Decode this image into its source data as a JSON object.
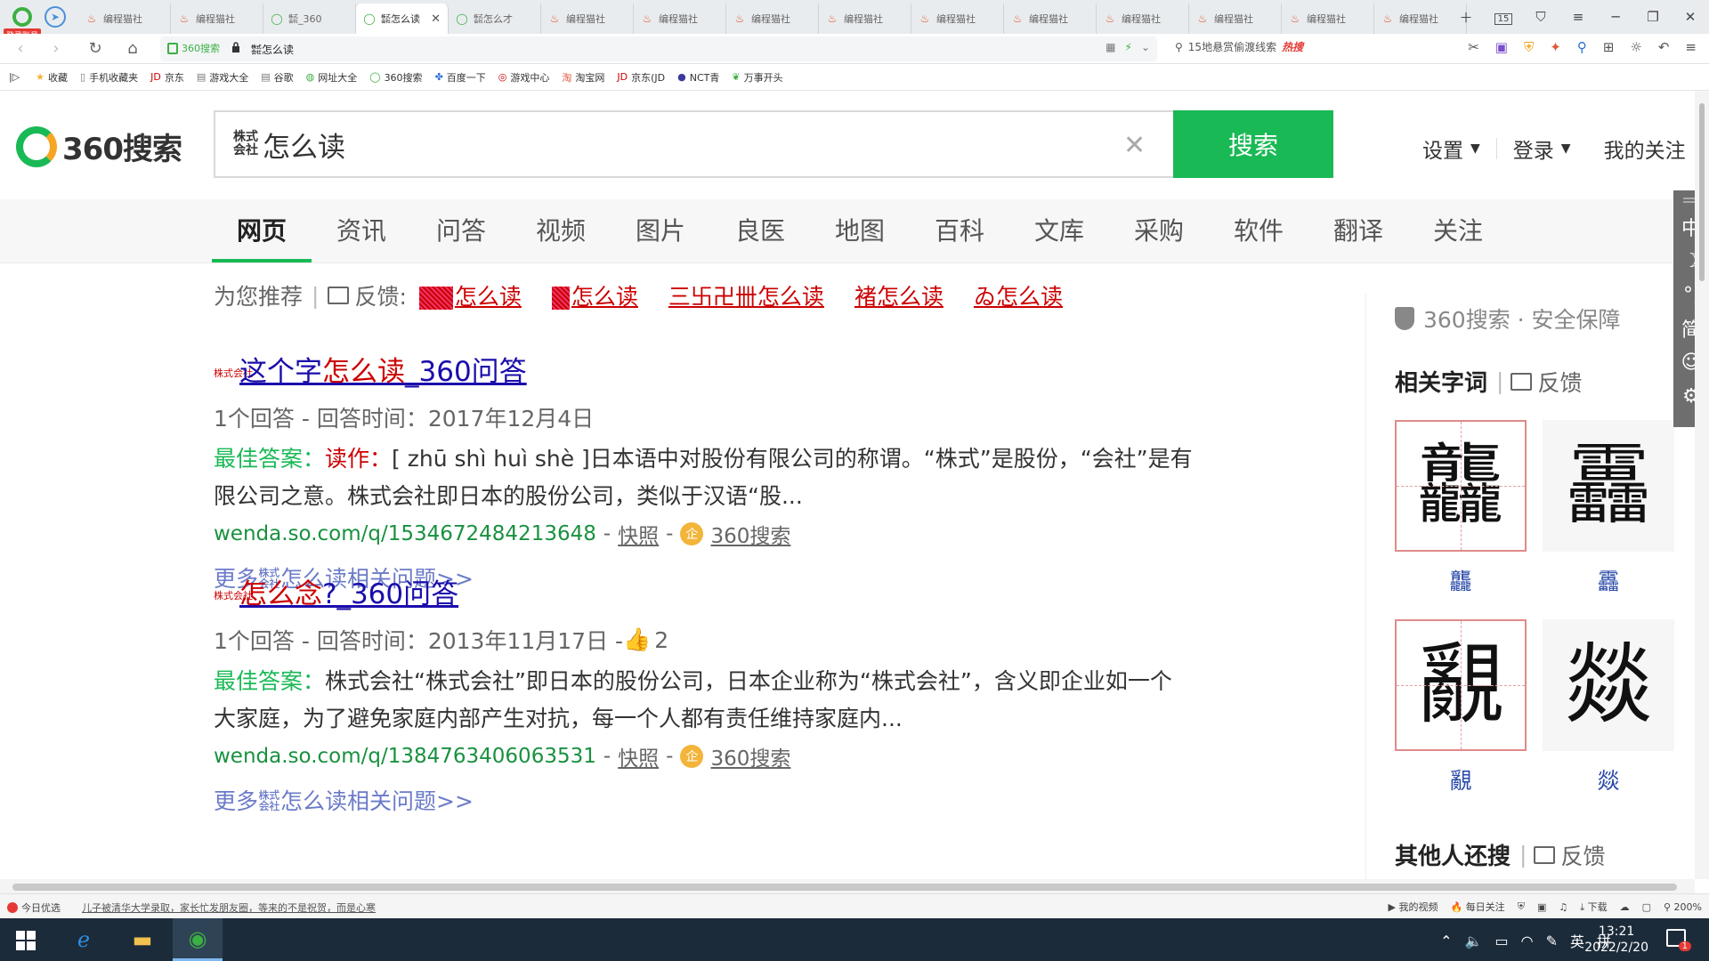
{
  "browser": {
    "account_badge": "登录账号",
    "tabs": [
      {
        "title": "编程猫社",
        "icon": "fire-icon",
        "active": false
      },
      {
        "title": "编程猫社",
        "icon": "fire-icon",
        "active": false
      },
      {
        "title": "㍿_360",
        "icon": "360-search-icon",
        "active": false
      },
      {
        "title": "㍿怎么读",
        "icon": "360-search-icon",
        "active": true
      },
      {
        "title": "㍿怎么才",
        "icon": "360-search-icon",
        "active": false
      },
      {
        "title": "编程猫社",
        "icon": "fire-icon",
        "active": false
      },
      {
        "title": "编程猫社",
        "icon": "fire-icon",
        "active": false
      },
      {
        "title": "编程猫社",
        "icon": "fire-icon",
        "active": false
      },
      {
        "title": "编程猫社",
        "icon": "fire-icon",
        "active": false
      },
      {
        "title": "编程猫社",
        "icon": "fire-icon",
        "active": false
      },
      {
        "title": "编程猫社",
        "icon": "fire-icon",
        "active": false
      },
      {
        "title": "编程猫社",
        "icon": "fire-icon",
        "active": false
      },
      {
        "title": "编程猫社",
        "icon": "fire-icon",
        "active": false
      },
      {
        "title": "编程猫社",
        "icon": "fire-icon",
        "active": false
      },
      {
        "title": "编程猫社",
        "icon": "fire-icon",
        "active": false
      }
    ],
    "tab_count": "15",
    "security_label": "360搜索",
    "url": "㍿怎么读",
    "hot_search_text": "15地悬赏偷渡线索",
    "hot_label": "热搜"
  },
  "bookmarks": [
    "收藏",
    "手机收藏夹",
    "京东",
    "游戏大全",
    "谷歌",
    "网址大全",
    "360搜索",
    "百度一下",
    "游戏中心",
    "淘宝网",
    "京东(JD",
    "NCT青",
    "万事开头"
  ],
  "search": {
    "logo_text": "360搜索",
    "query_glyph": "株式会社",
    "query_text": "怎么读",
    "button_label": "搜索",
    "links": {
      "settings": "设置",
      "login": "登录",
      "follow": "我的关注"
    }
  },
  "vertical_tabs": [
    "网页",
    "资讯",
    "问答",
    "视频",
    "图片",
    "良医",
    "地图",
    "百科",
    "文库",
    "采购",
    "软件",
    "翻译",
    "关注"
  ],
  "recommend": {
    "label": "为您推荐",
    "feedback": "反馈:",
    "items": [
      "怎么读",
      "怎么读",
      "三卐卍卌怎么读",
      "褚怎么读",
      "ゐ怎么读"
    ]
  },
  "results": [
    {
      "title_glyph": "株式会社",
      "title_pre": "这个字",
      "title_em": "怎么读",
      "title_post": "_360问答",
      "meta": "1个回答 - 回答时间：2017年12月4日",
      "likes": "",
      "snippet_label": "最佳答案：",
      "snippet_em": "读作：",
      "snippet_text": "[ zhū shì huì shè ]日本语中对股份有限公司的称谓。“株式”是股份，“会社”是有限公司之意。株式会社即日本的股份公司，类似于汉语“股...",
      "cite_url": "wenda.so.com/q/1534672484213648",
      "cite_snapshot": "快照",
      "cite_source": "360搜索",
      "more": "更多㍿怎么读相关问题>>"
    },
    {
      "title_glyph": "株式会社",
      "title_pre": "",
      "title_em": "怎么念",
      "title_post": "?_360问答",
      "meta": "1个回答 - 回答时间：2013年11月17日 - ",
      "likes": "2",
      "snippet_label": "最佳答案：",
      "snippet_em": "",
      "snippet_text": "株式会社“株式会社”即日本的股份公司，日本企业称为“株式会社”，含义即企业如一个大家庭，为了避免家庭内部产生对抗，每一个人都有责任维持家庭内...",
      "cite_url": "wenda.so.com/q/1384763406063531",
      "cite_snapshot": "快照",
      "cite_source": "360搜索",
      "more": "更多㍿怎么读相关问题>>"
    }
  ],
  "sidebar": {
    "safety": "360搜索 · 安全保障",
    "related_title": "相关字词",
    "feedback": "反馈",
    "chars": [
      {
        "glyph": "龘",
        "label": "龘",
        "style": "grid"
      },
      {
        "glyph": "靐",
        "label": "靐",
        "style": "plain"
      },
      {
        "glyph": "覶",
        "label": "覶",
        "style": "grid"
      },
      {
        "glyph": "燚",
        "label": "燚",
        "style": "plain"
      }
    ],
    "others_title": "其他人还搜"
  },
  "float_tools": [
    "中",
    "☽",
    "°,",
    "简",
    "☺",
    "⚙"
  ],
  "statusbar": {
    "today": "今日优选",
    "news": "儿子被清华大学录取，家长忙发朋友圈，等来的不是祝贺，而是心寒",
    "right_items": [
      "我的视频",
      "每日关注",
      "下载",
      "200%"
    ]
  },
  "taskbar": {
    "time": "13:21",
    "date": "2022/2/20",
    "ime": "英",
    "ime2": "拼",
    "notif_count": "1"
  }
}
